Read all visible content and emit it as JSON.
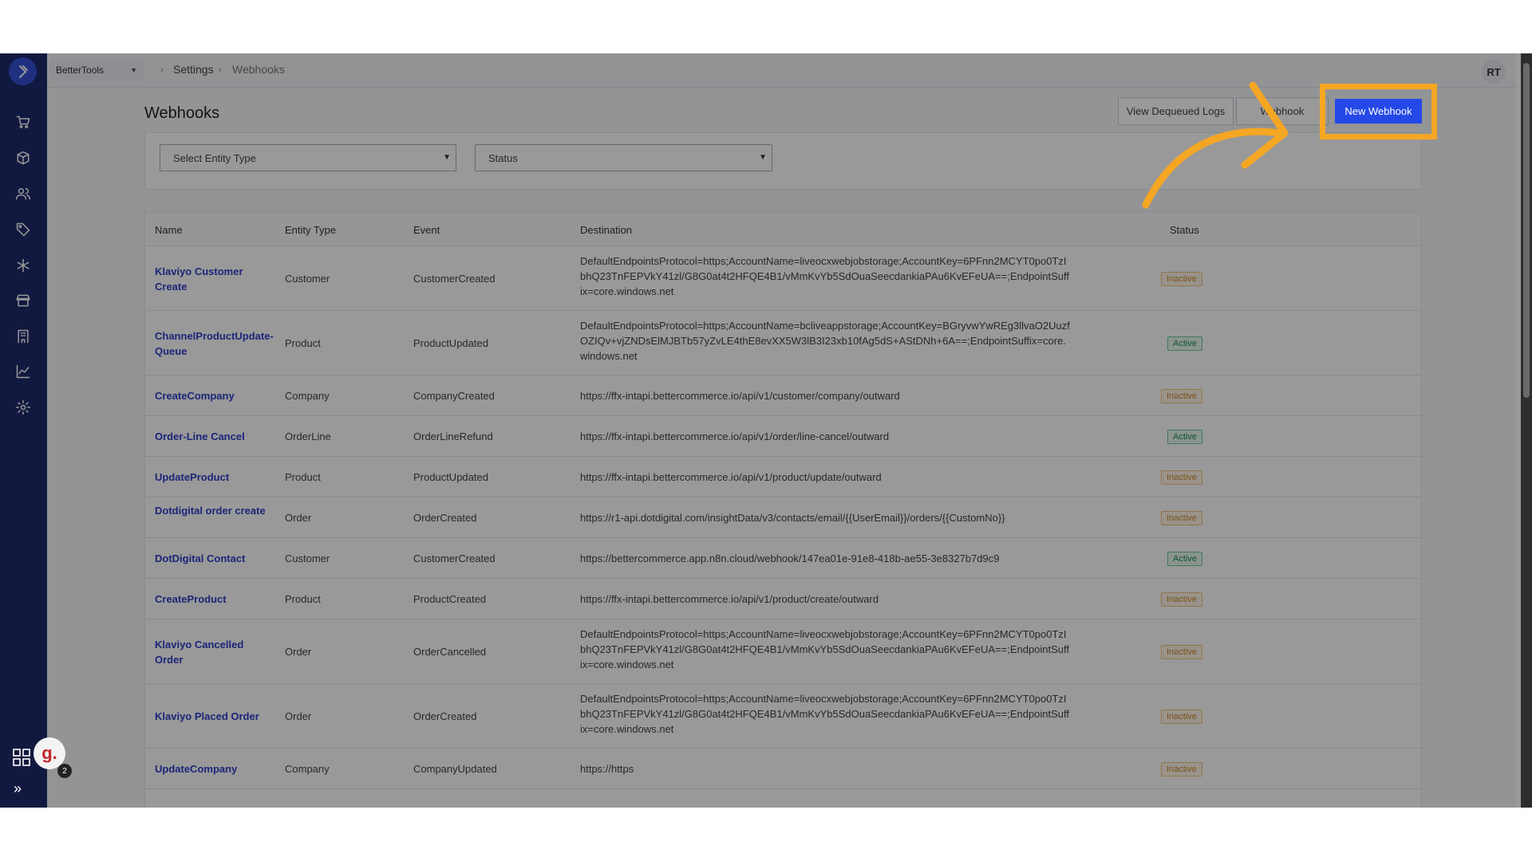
{
  "topbar": {
    "store": "BetterTools",
    "breadcrumbs": [
      "Settings",
      "Webhooks"
    ],
    "avatar": "RT"
  },
  "page": {
    "title": "Webhooks",
    "view_dequeued_label": "View Dequeued Logs",
    "webhook_logs_label": "Webhook",
    "new_webhook_label": "New Webhook"
  },
  "filters": {
    "entity_type": "Select Entity Type",
    "status": "Status"
  },
  "table": {
    "headers": [
      "Name",
      "Entity Type",
      "Event",
      "Destination",
      "Status"
    ],
    "rows": [
      {
        "name": "Klaviyo Customer Create",
        "entity": "Customer",
        "event": "CustomerCreated",
        "dest": "DefaultEndpointsProtocol=https;AccountName=liveocxwebjobstorage;AccountKey=6PFnn2MCYT0po0TzIbhQ23TnFEPVkY41zl/G8G0at4t2HFQE4B1/vMmKvYb5SdOuaSeecdankiaPAu6KvEFeUA==;EndpointSuffix=core.windows.net",
        "status": "Inactive"
      },
      {
        "name": "ChannelProductUpdate-Queue",
        "entity": "Product",
        "event": "ProductUpdated",
        "dest": "DefaultEndpointsProtocol=https;AccountName=bcliveappstorage;AccountKey=BGryvwYwREg3llvaO2UuzfOZIQv+vjZNDsElMJBTb57yZvLE4thE8evXX5W3lB3I23xb10fAg5dS+AStDNh+6A==;EndpointSuffix=core.windows.net",
        "status": "Active"
      },
      {
        "name": "CreateCompany",
        "entity": "Company",
        "event": "CompanyCreated",
        "dest": "https://ffx-intapi.bettercommerce.io/api/v1/customer/company/outward",
        "status": "Inactive"
      },
      {
        "name": "Order-Line Cancel",
        "entity": "OrderLine",
        "event": "OrderLineRefund",
        "dest": "https://ffx-intapi.bettercommerce.io/api/v1/order/line-cancel/outward",
        "status": "Active"
      },
      {
        "name": "UpdateProduct",
        "entity": "Product",
        "event": "ProductUpdated",
        "dest": "https://ffx-intapi.bettercommerce.io/api/v1/product/update/outward",
        "status": "Inactive"
      },
      {
        "name": "Dotdigital order create",
        "entity": "Order",
        "event": "OrderCreated",
        "dest": "https://r1-api.dotdigital.com/insightData/v3/contacts/email/{{UserEmail}}/orders/{{CustomNo}}",
        "status": "Inactive"
      },
      {
        "name": "DotDigital Contact",
        "entity": "Customer",
        "event": "CustomerCreated",
        "dest": "https://bettercommerce.app.n8n.cloud/webhook/147ea01e-91e8-418b-ae55-3e8327b7d9c9",
        "status": "Active"
      },
      {
        "name": "CreateProduct",
        "entity": "Product",
        "event": "ProductCreated",
        "dest": "https://ffx-intapi.bettercommerce.io/api/v1/product/create/outward",
        "status": "Inactive"
      },
      {
        "name": "Klaviyo Cancelled Order",
        "entity": "Order",
        "event": "OrderCancelled",
        "dest": "DefaultEndpointsProtocol=https;AccountName=liveocxwebjobstorage;AccountKey=6PFnn2MCYT0po0TzIbhQ23TnFEPVkY41zl/G8G0at4t2HFQE4B1/vMmKvYb5SdOuaSeecdankiaPAu6KvEFeUA==;EndpointSuffix=core.windows.net",
        "status": "Inactive"
      },
      {
        "name": "Klaviyo Placed Order",
        "entity": "Order",
        "event": "OrderCreated",
        "dest": "DefaultEndpointsProtocol=https;AccountName=liveocxwebjobstorage;AccountKey=6PFnn2MCYT0po0TzIbhQ23TnFEPVkY41zl/G8G0at4t2HFQE4B1/vMmKvYb5SdOuaSeecdankiaPAu6KvEFeUA==;EndpointSuffix=core.windows.net",
        "status": "Inactive"
      },
      {
        "name": "UpdateCompany",
        "entity": "Company",
        "event": "CompanyUpdated",
        "dest": "https://https",
        "status": "Inactive"
      }
    ]
  },
  "widgets": {
    "chat_letter": "g.",
    "chat_count": "2"
  },
  "colors": {
    "sidebar": "#1f2a6b",
    "primary": "#2449e8",
    "highlight": "#f5a623"
  }
}
